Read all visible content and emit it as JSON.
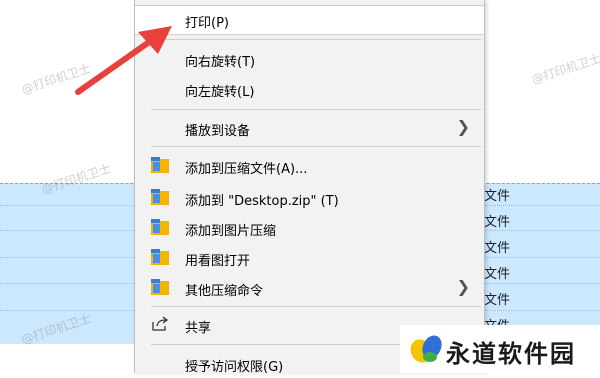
{
  "menu": {
    "items": [
      {
        "label": "打印(P)"
      },
      {
        "label": "向右旋转(T)"
      },
      {
        "label": "向左旋转(L)"
      },
      {
        "label": "播放到设备"
      },
      {
        "label": "添加到压缩文件(A)..."
      },
      {
        "label": "添加到 \"Desktop.zip\" (T)"
      },
      {
        "label": "添加到图片压缩"
      },
      {
        "label": "用看图打开"
      },
      {
        "label": "其他压缩命令"
      },
      {
        "label": "共享"
      },
      {
        "label": "授予访问权限(G)"
      }
    ]
  },
  "background": {
    "row_text": "文件"
  },
  "watermark": "@打印机卫士",
  "brand": {
    "name": "永道软件园"
  },
  "colors": {
    "arrow": "#e8403a",
    "selection": "#cce8ff",
    "menu_bg": "#f2f2f2"
  }
}
